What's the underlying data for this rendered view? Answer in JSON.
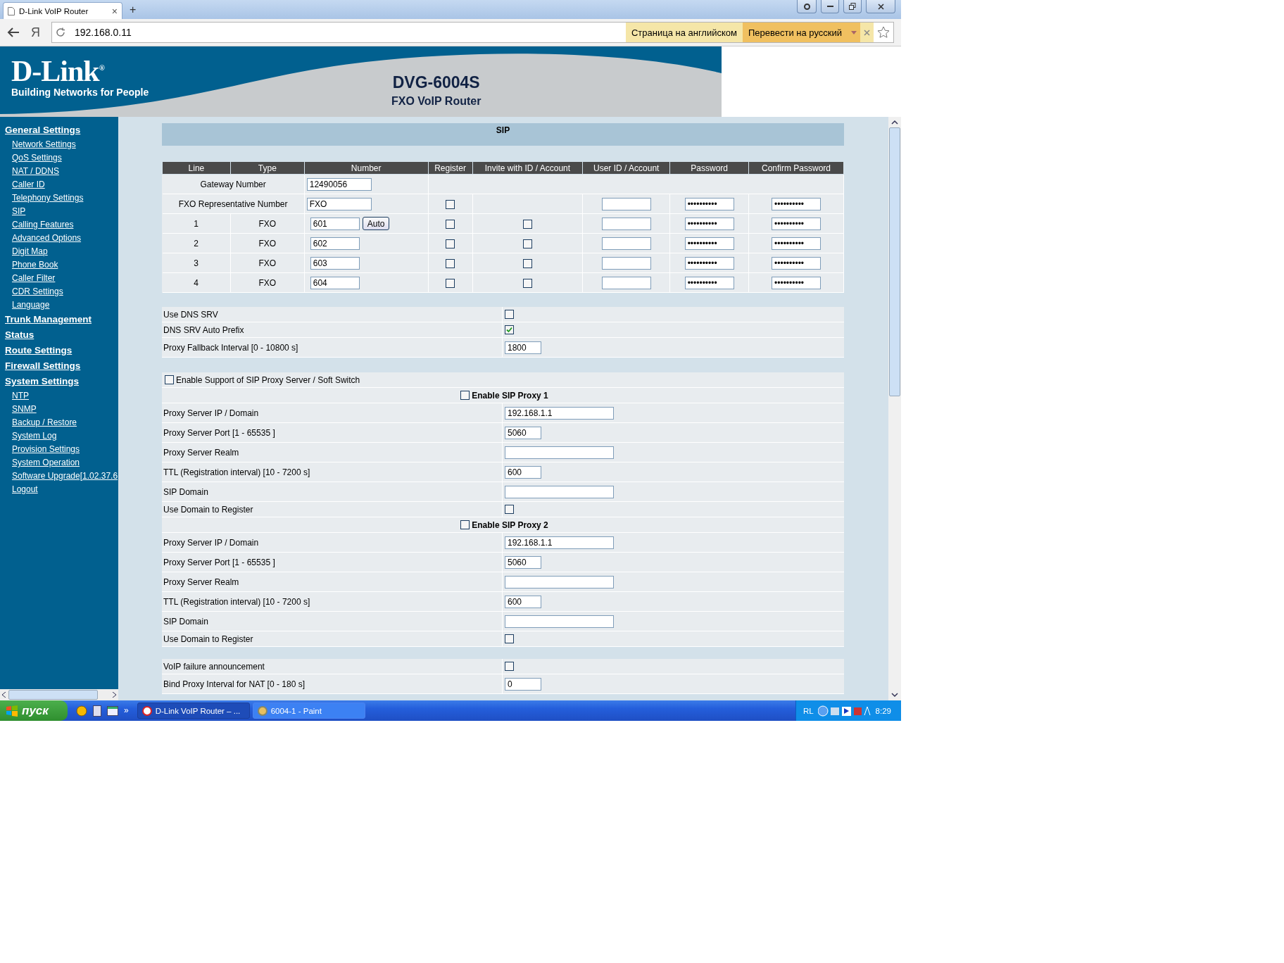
{
  "browser": {
    "tab_title": "D-Link VoIP Router",
    "tab_close": "×",
    "new_tab": "+",
    "yandex_button": "Я",
    "url": "192.168.0.11",
    "translate_notice": "Страница на английском",
    "translate_button": "Перевести на русский"
  },
  "header": {
    "logo": "D-Link",
    "logo_mark": "®",
    "tagline": "Building Networks for People",
    "model": "DVG-6004S",
    "product": "FXO VoIP Router"
  },
  "sidebar": {
    "groups": [
      {
        "label": "General Settings",
        "children": [
          "Network Settings",
          "QoS Settings",
          "NAT / DDNS",
          "Caller ID",
          "Telephony Settings",
          "SIP",
          "Calling Features",
          "Advanced Options",
          "Digit Map",
          "Phone Book",
          "Caller Filter",
          "CDR Settings",
          "Language"
        ]
      },
      {
        "label": "Trunk Management"
      },
      {
        "label": "Status"
      },
      {
        "label": "Route Settings"
      },
      {
        "label": "Firewall Settings"
      },
      {
        "label": "System Settings",
        "children": [
          "NTP",
          "SNMP",
          "Backup / Restore",
          "System Log",
          "Provision Settings",
          "System Operation",
          "Software Upgrade[1.02.37.6",
          "Logout"
        ]
      }
    ]
  },
  "sip": {
    "title": "SIP",
    "columns": [
      "Line",
      "Type",
      "Number",
      "Register",
      "Invite with ID / Account",
      "User ID / Account",
      "Password",
      "Confirm Password"
    ],
    "gateway": {
      "label": "Gateway Number",
      "number": "12490056"
    },
    "representative": {
      "label": "FXO Representative Number",
      "number": "FXO",
      "register": false,
      "password": "••••••••••",
      "confirm": "••••••••••"
    },
    "lines": [
      {
        "line": "1",
        "type": "FXO",
        "number": "601",
        "button": "Auto",
        "register": false,
        "invite": false,
        "password": "••••••••••",
        "confirm": "••••••••••"
      },
      {
        "line": "2",
        "type": "FXO",
        "number": "602",
        "register": false,
        "invite": false,
        "password": "••••••••••",
        "confirm": "••••••••••"
      },
      {
        "line": "3",
        "type": "FXO",
        "number": "603",
        "register": false,
        "invite": false,
        "password": "••••••••••",
        "confirm": "••••••••••"
      },
      {
        "line": "4",
        "type": "FXO",
        "number": "604",
        "register": false,
        "invite": false,
        "password": "••••••••••",
        "confirm": "••••••••••"
      }
    ],
    "dns": [
      {
        "label": "Use DNS SRV",
        "kind": "checkbox",
        "checked": false
      },
      {
        "label": "DNS SRV Auto Prefix",
        "kind": "checkbox",
        "checked": true
      },
      {
        "label": "Proxy Fallback Interval [0 - 10800 s]",
        "kind": "field",
        "value": "1800"
      }
    ],
    "proxy_support": {
      "label": "Enable Support of SIP Proxy Server / Soft Switch",
      "checked": false
    },
    "proxies": [
      {
        "title": "Enable SIP Proxy 1",
        "enabled": false,
        "rows": [
          {
            "label": "Proxy Server IP / Domain",
            "kind": "wide_field",
            "value": "192.168.1.1"
          },
          {
            "label": "Proxy Server Port [1 - 65535 ]",
            "kind": "field",
            "value": "5060"
          },
          {
            "label": "Proxy Server Realm",
            "kind": "wide_field"
          },
          {
            "label": "TTL (Registration interval) [10 - 7200 s]",
            "kind": "field",
            "value": "600"
          },
          {
            "label": "SIP Domain",
            "kind": "wide_field"
          },
          {
            "label": "Use Domain to Register",
            "kind": "checkbox",
            "checked": false
          }
        ]
      },
      {
        "title": "Enable SIP Proxy 2",
        "enabled": false,
        "rows": [
          {
            "label": "Proxy Server IP / Domain",
            "kind": "wide_field",
            "value": "192.168.1.1"
          },
          {
            "label": "Proxy Server Port [1 - 65535 ]",
            "kind": "field",
            "value": "5060"
          },
          {
            "label": "Proxy Server Realm",
            "kind": "wide_field"
          },
          {
            "label": "TTL (Registration interval) [10 - 7200 s]",
            "kind": "field",
            "value": "600"
          },
          {
            "label": "SIP Domain",
            "kind": "wide_field"
          },
          {
            "label": "Use Domain to Register",
            "kind": "checkbox",
            "checked": false
          }
        ]
      }
    ],
    "misc": [
      {
        "label": "VoIP failure announcement",
        "kind": "checkbox",
        "checked": false
      },
      {
        "label": "Bind Proxy Interval for NAT [0 - 180 s]",
        "kind": "field",
        "value": "0"
      }
    ]
  },
  "taskbar": {
    "start": "пуск",
    "more": "»",
    "tasks": [
      {
        "label": "D-Link VoIP Router – ...",
        "selected": true
      },
      {
        "label": "6004-1 - Paint",
        "selected": false
      }
    ],
    "language": "RL",
    "clock": "8:29"
  }
}
